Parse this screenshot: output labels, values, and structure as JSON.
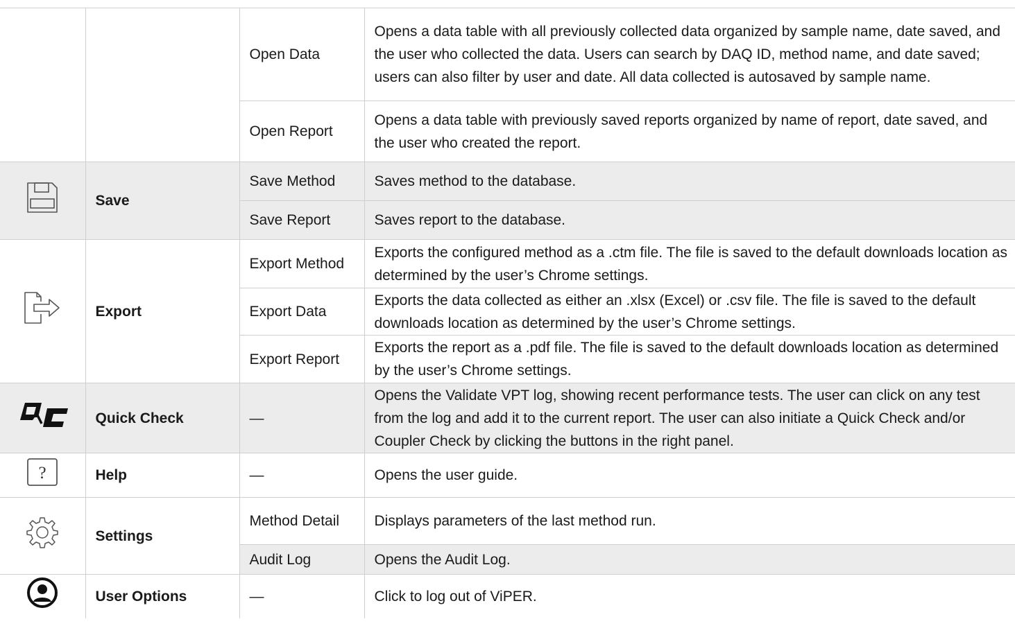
{
  "open": {
    "rows": [
      {
        "action": "Open Data",
        "description": "Opens a data table with all previously collected data organized by sample name, date saved, and the user who collected the data. Users can search by DAQ ID, method name, and date saved; users can also filter by user and date. All data collected is autosaved by sample name."
      },
      {
        "action": "Open Report",
        "description": "Opens a data table with previously saved reports organized by name of report, date saved, and the user who created the report."
      }
    ]
  },
  "save": {
    "icon": "floppy-disk-icon",
    "title": "Save",
    "rows": [
      {
        "action": "Save Method",
        "description": "Saves method to the database."
      },
      {
        "action": "Save Report",
        "description": "Saves report to the database."
      }
    ]
  },
  "export": {
    "icon": "export-file-icon",
    "title": "Export",
    "rows": [
      {
        "action": "Export Method",
        "description": "Exports the configured method as a .ctm file. The file is saved to the default downloads location as determined by the user’s Chrome settings."
      },
      {
        "action": "Export Data",
        "description": "Exports the data collected as either an .xlsx (Excel) or .csv file. The file is saved to the default downloads location as determined by the user’s Chrome settings."
      },
      {
        "action": "Export Report",
        "description": "Exports the report as a .pdf file. The file is saved to the default downloads location as determined by the user’s Chrome settings."
      }
    ]
  },
  "quick_check": {
    "icon": "quick-check-logo-icon",
    "title": "Quick Check",
    "action": "—",
    "description": "Opens the Validate VPT log, showing recent performance tests. The user can click on any test from the log and add it to the current report. The user can also initiate a Quick Check and/or Coupler Check by clicking the buttons in the right panel."
  },
  "help": {
    "icon": "help-icon",
    "title": "Help",
    "action": "—",
    "description": "Opens the user guide."
  },
  "settings": {
    "icon": "gear-icon",
    "title": "Settings",
    "rows": [
      {
        "action": "Method Detail",
        "description": "Displays parameters of the last method run."
      },
      {
        "action": "Audit Log",
        "description": "Opens the Audit Log."
      }
    ]
  },
  "user_options": {
    "icon": "user-profile-icon",
    "title": "User Options",
    "action": "—",
    "description": "Click to log out of ViPER."
  }
}
